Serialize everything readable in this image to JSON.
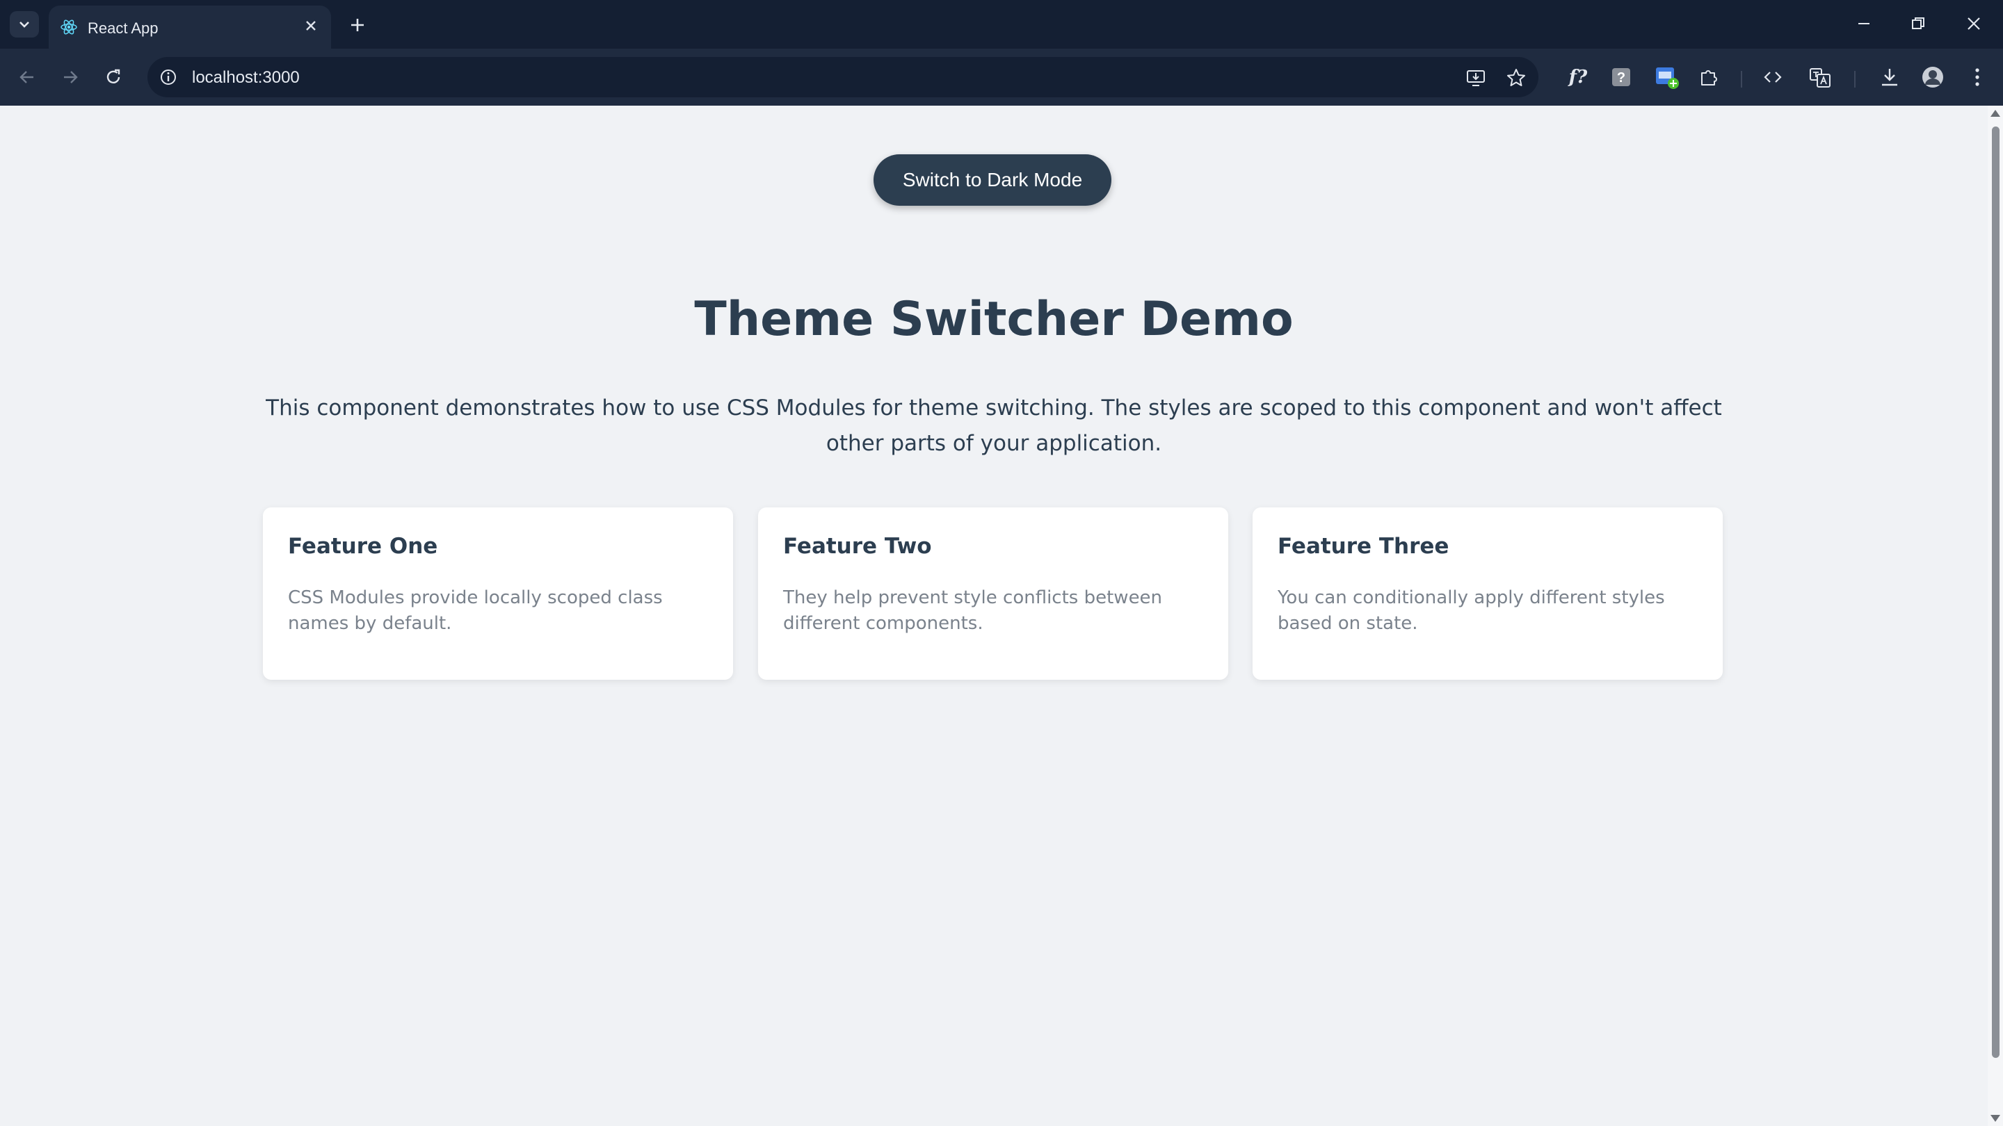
{
  "browser": {
    "tab_title": "React App",
    "url": "localhost:3000",
    "icons": {
      "tab_menu": "chevron-down-icon",
      "tab_favicon": "react-icon",
      "tab_close": "close-icon",
      "new_tab": "plus-icon",
      "back": "arrow-left-icon",
      "forward": "arrow-right-icon",
      "reload": "reload-icon",
      "site_info": "info-icon",
      "install": "install-app-icon",
      "bookmark": "star-icon",
      "extensions": [
        "function-icon",
        "help-icon",
        "extension-badge-icon",
        "puzzle-icon",
        "code-icon",
        "translate-icon"
      ],
      "downloads": "download-icon",
      "profile": "avatar-icon",
      "menu": "kebab-menu-icon"
    }
  },
  "page": {
    "theme_button_label": "Switch to Dark Mode",
    "title": "Theme Switcher Demo",
    "description": "This component demonstrates how to use CSS Modules for theme switching. The styles are scoped to this component and won't affect other parts of your application.",
    "cards": [
      {
        "title": "Feature One",
        "text": "CSS Modules provide locally scoped class names by default."
      },
      {
        "title": "Feature Two",
        "text": "They help prevent style conflicts between different components."
      },
      {
        "title": "Feature Three",
        "text": "You can conditionally apply different styles based on state."
      }
    ]
  },
  "colors": {
    "chrome_dark": "#141f33",
    "toolbar": "#1f2b40",
    "page_bg": "#f0f2f5",
    "primary": "#2c3e50",
    "card_text": "#7a828c"
  }
}
